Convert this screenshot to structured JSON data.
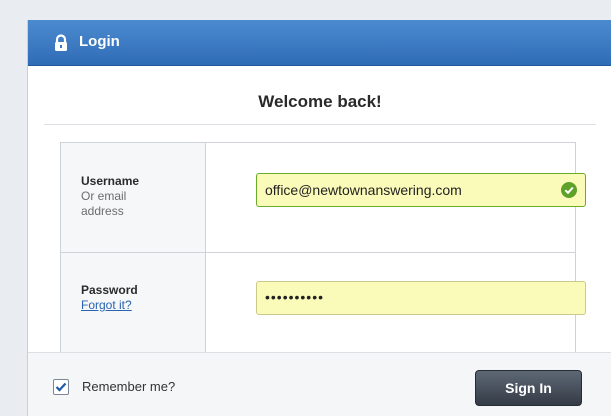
{
  "header": {
    "title": "Login",
    "icon": "lock-icon"
  },
  "welcome": "Welcome back!",
  "username": {
    "label": "Username",
    "sublabel": "Or email address",
    "value": "office@newtownanswering.com",
    "valid_icon": "check-circle-icon"
  },
  "password": {
    "label": "Password",
    "forgot_link": "Forgot it?",
    "value": "••••••••••"
  },
  "remember": {
    "label": "Remember me?",
    "checked": true
  },
  "signin_label": "Sign In",
  "colors": {
    "header": "#3b78c2",
    "input_fill": "#fbfbb9",
    "valid_green": "#5da12a",
    "button": "#474f5b",
    "link": "#2a64b0"
  }
}
